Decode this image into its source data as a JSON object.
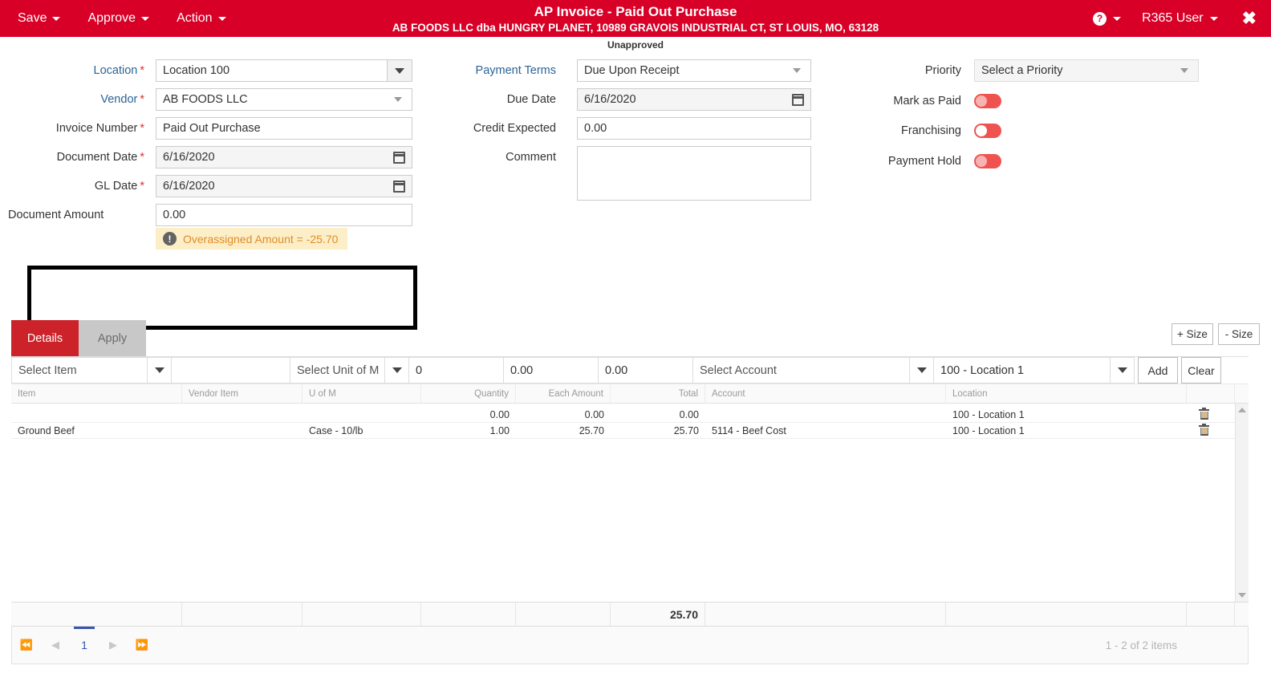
{
  "topbar": {
    "menus": [
      {
        "label": "Save",
        "name": "save-menu"
      },
      {
        "label": "Approve",
        "name": "approve-menu"
      },
      {
        "label": "Action",
        "name": "action-menu"
      }
    ],
    "title": "AP Invoice - Paid Out Purchase",
    "subtitle": "AB FOODS LLC dba HUNGRY PLANET, 10989 GRAVOIS INDUSTRIAL CT, ST LOUIS, MO, 63128",
    "help_glyph": "?",
    "user": "R365 User",
    "close_glyph": "✖",
    "brand_color": "#d80027"
  },
  "status": "Unapproved",
  "form": {
    "left": {
      "location": {
        "label": "Location",
        "required": true,
        "value": "Location 100"
      },
      "vendor": {
        "label": "Vendor",
        "required": true,
        "value": "AB FOODS LLC"
      },
      "invoice_number": {
        "label": "Invoice Number",
        "required": true,
        "value": "Paid Out Purchase"
      },
      "document_date": {
        "label": "Document Date",
        "required": true,
        "value": "6/16/2020"
      },
      "gl_date": {
        "label": "GL Date",
        "required": true,
        "value": "6/16/2020"
      },
      "document_amount": {
        "label": "Document Amount",
        "required": false,
        "value": "0.00"
      },
      "warning": {
        "text": "Overassigned Amount = -25.70",
        "glyph": "!",
        "bg": "#fcefc7",
        "fg": "#e08b2a"
      }
    },
    "middle": {
      "payment_terms": {
        "label": "Payment Terms",
        "value": "Due Upon Receipt"
      },
      "due_date": {
        "label": "Due Date",
        "value": "6/16/2020"
      },
      "credit_expected": {
        "label": "Credit Expected",
        "value": "0.00"
      },
      "comment": {
        "label": "Comment",
        "value": "",
        "placeholder": ""
      }
    },
    "right": {
      "priority": {
        "label": "Priority",
        "value": "Select a Priority"
      },
      "mark_as_paid": {
        "label": "Mark as Paid",
        "on": false
      },
      "franchising": {
        "label": "Franchising",
        "on": false
      },
      "payment_hold": {
        "label": "Payment Hold",
        "on": false
      },
      "toggle_color": "#ef5350"
    }
  },
  "tabs": [
    {
      "label": "Details",
      "active": true
    },
    {
      "label": "Apply",
      "active": false
    }
  ],
  "size_buttons": [
    {
      "label": "+ Size"
    },
    {
      "label": "- Size"
    }
  ],
  "grid": {
    "entry": {
      "item": "Select Item",
      "vendor_item": "",
      "uofm": "Select Unit of M",
      "quantity": "0",
      "each_amount": "0.00",
      "total": "0.00",
      "account": "Select Account",
      "location": "100 - Location 1",
      "add_label": "Add",
      "clear_label": "Clear"
    },
    "columns": [
      "Item",
      "Vendor Item",
      "U of M",
      "Quantity",
      "Each Amount",
      "Total",
      "Account",
      "Location",
      ""
    ],
    "rows": [
      {
        "item": "",
        "vendor_item": "",
        "uofm": "",
        "quantity": "0.00",
        "each_amount": "0.00",
        "total": "0.00",
        "account": "",
        "location": "100 - Location 1"
      },
      {
        "item": "Ground Beef",
        "vendor_item": "",
        "uofm": "Case - 10/lb",
        "quantity": "1.00",
        "each_amount": "25.70",
        "total": "25.70",
        "account": "5114 - Beef Cost",
        "location": "100 - Location 1"
      }
    ],
    "totals": {
      "total": "25.70"
    },
    "pager": {
      "first": "⏪",
      "prev": "◀",
      "page": "1",
      "next": "▶",
      "last": "⏩",
      "info": "1 - 2 of 2 items"
    }
  }
}
